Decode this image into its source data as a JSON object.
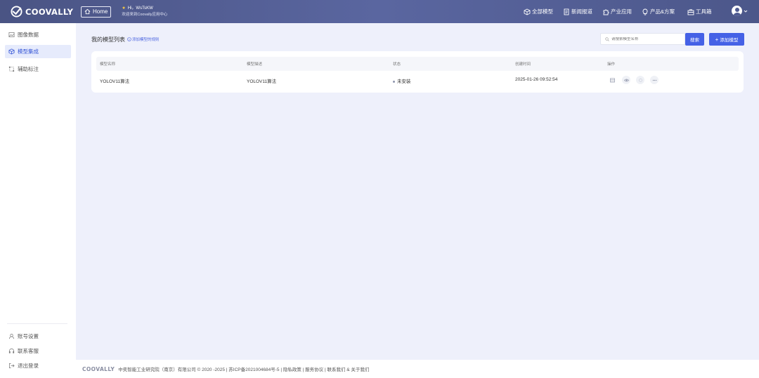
{
  "header": {
    "brand": "COOVALLY",
    "home_label": "Home",
    "greeting": "Hi，WsTsKW",
    "welcome": "欢迎来到Coovally应用中心",
    "nav": [
      {
        "label": "全部模型",
        "icon": "model-box-icon"
      },
      {
        "label": "新闻报道",
        "icon": "document-icon"
      },
      {
        "label": "产业应用",
        "icon": "puzzle-icon"
      },
      {
        "label": "产品&方案",
        "icon": "bulb-icon"
      },
      {
        "label": "工具箱",
        "icon": "toolbox-icon"
      }
    ]
  },
  "sidebar": {
    "items": [
      {
        "label": "图像数据",
        "icon": "image-icon"
      },
      {
        "label": "模型集成",
        "icon": "cube-icon"
      },
      {
        "label": "辅助标注",
        "icon": "annotate-icon"
      }
    ],
    "bottom": [
      {
        "label": "账号设置",
        "icon": "user-icon"
      },
      {
        "label": "联系客服",
        "icon": "headset-icon"
      },
      {
        "label": "退出登录",
        "icon": "logout-icon"
      }
    ]
  },
  "main": {
    "title": "我的模型列表",
    "hint": "添加模型的规则",
    "search_placeholder": "请搜索模型名称",
    "search_label": "搜索",
    "add_label": "添加模型",
    "columns": [
      "模型名称",
      "模型描述",
      "状态",
      "创建时间",
      "操作"
    ],
    "rows": [
      {
        "name": "YOLOV11算法",
        "desc": "YOLOV11算法",
        "status": "未安装",
        "created": "2025-01-26 09:52:54"
      }
    ]
  },
  "footer": {
    "brand": "COOVALLY",
    "text": "中奕智能工业研究院（南京）有限公司 © 2020 -2025 | 苏ICP备2021004684号-5 | 隐私政策 | 服务协议 | 联系我们  &  关于我们"
  },
  "colors": {
    "header": "#525d93",
    "accent": "#4561e6",
    "background": "#eef0fb"
  }
}
